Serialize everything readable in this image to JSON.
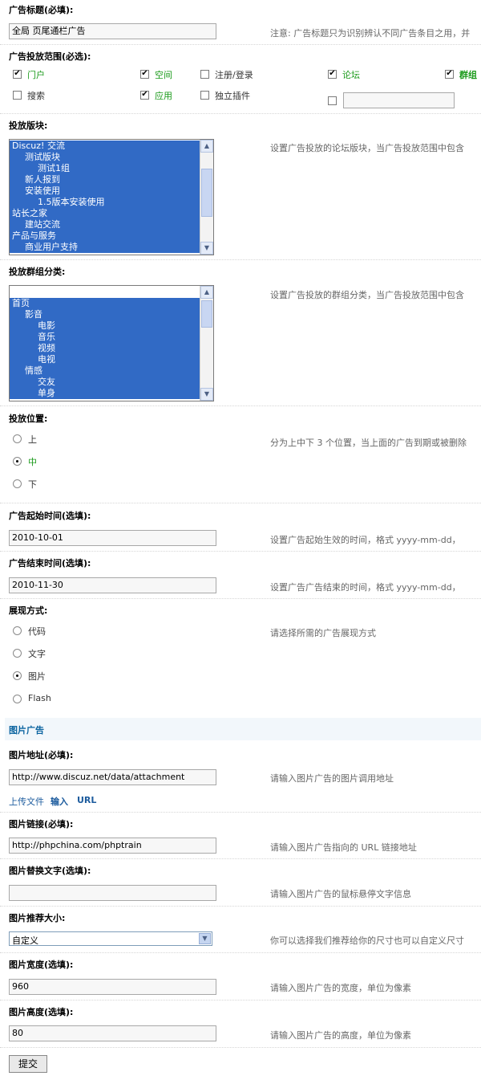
{
  "title_field": {
    "label": "广告标题(必填):",
    "value": "全局 页尾通栏广告",
    "hint": "注意: 广告标题只为识别辨认不同广告条目之用，并"
  },
  "scope": {
    "label": "广告投放范围(必选):",
    "options": [
      {
        "label": "门户",
        "checked": true
      },
      {
        "label": "空间",
        "checked": true
      },
      {
        "label": "注册/登录",
        "checked": false
      },
      {
        "label": "论坛",
        "checked": true
      },
      {
        "label": "群组",
        "checked": true
      },
      {
        "label": "搜索",
        "checked": false
      },
      {
        "label": "应用",
        "checked": true
      },
      {
        "label": "独立插件",
        "checked": false
      }
    ],
    "custom_checked": false,
    "custom_value": ""
  },
  "forums": {
    "label": "投放版块:",
    "hint": "设置广告投放的论坛版块，当广告投放范围中包含",
    "items": [
      "Discuz! 交流",
      "测试版块",
      "测试1组",
      "新人报到",
      "安装使用",
      "1.5版本安装使用",
      "站长之家",
      "建站交流",
      "产品与服务",
      "商业用户支持"
    ]
  },
  "groups": {
    "label": "投放群组分类:",
    "hint": "设置广告投放的群组分类，当广告投放范围中包含",
    "items": [
      "首页",
      "影音",
      "电影",
      "音乐",
      "视频",
      "电视",
      "情感",
      "交友",
      "单身"
    ]
  },
  "position": {
    "label": "投放位置:",
    "hint": "分为上中下 3 个位置，当上面的广告到期或被删除",
    "options": [
      {
        "label": "上",
        "checked": false
      },
      {
        "label": "中",
        "checked": true
      },
      {
        "label": "下",
        "checked": false
      }
    ]
  },
  "start_time": {
    "label": "广告起始时间(选填):",
    "value": "2010-10-01",
    "hint": "设置广告起始生效的时间，格式 yyyy-mm-dd，"
  },
  "end_time": {
    "label": "广告结束时间(选填):",
    "value": "2010-11-30",
    "hint": "设置广告广告结束的时间，格式 yyyy-mm-dd，"
  },
  "display": {
    "label": "展现方式:",
    "hint": "请选择所需的广告展现方式",
    "options": [
      {
        "label": "代码",
        "checked": false
      },
      {
        "label": "文字",
        "checked": false
      },
      {
        "label": "图片",
        "checked": true
      },
      {
        "label": "Flash",
        "checked": false
      }
    ]
  },
  "image_section": {
    "title": "图片广告"
  },
  "image_url": {
    "label": "图片地址(必填):",
    "value": "http://www.discuz.net/data/attachment",
    "hint": "请输入图片广告的图片调用地址",
    "tab_upload": "上传文件",
    "tab_input": "输入",
    "tab_url": "URL"
  },
  "image_link": {
    "label": "图片链接(必填):",
    "value": "http://phpchina.com/phptrain",
    "hint": "请输入图片广告指向的 URL 链接地址"
  },
  "image_alt": {
    "label": "图片替换文字(选填):",
    "value": "",
    "hint": "请输入图片广告的鼠标悬停文字信息"
  },
  "image_size": {
    "label": "图片推荐大小:",
    "value": "自定义",
    "hint": "你可以选择我们推荐给你的尺寸也可以自定义尺寸"
  },
  "image_width": {
    "label": "图片宽度(选填):",
    "value": "960",
    "hint": "请输入图片广告的宽度，单位为像素"
  },
  "image_height": {
    "label": "图片高度(选填):",
    "value": "80",
    "hint": "请输入图片广告的高度，单位为像素"
  },
  "submit": {
    "label": "提交"
  }
}
